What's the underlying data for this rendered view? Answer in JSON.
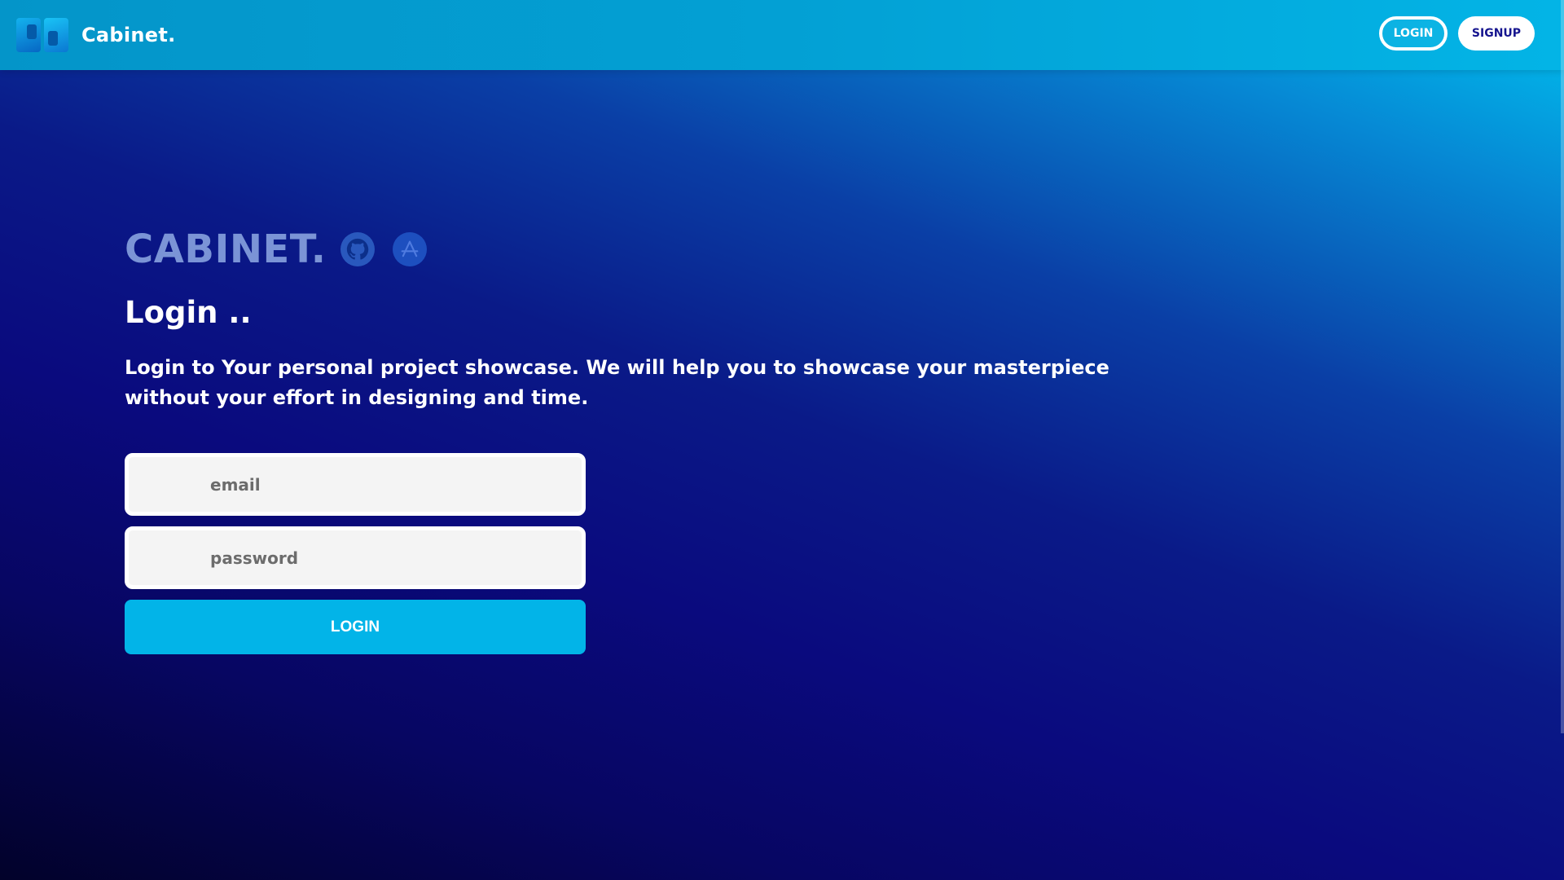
{
  "navbar": {
    "brand_name": "Cabinet.",
    "login_label": "LOGIN",
    "signup_label": "SIGNUP"
  },
  "hero": {
    "big_brand": "CABINET.",
    "social_icons": [
      "github-icon",
      "app-store-icon"
    ],
    "heading": "Login ..",
    "description": "Login to Your personal project showcase. We will help you to showcase your masterpiece without your effort in designing and time."
  },
  "form": {
    "email_placeholder": "email",
    "password_placeholder": "password",
    "submit_label": "LOGIN"
  },
  "colors": {
    "accent": "#02b4e8",
    "navbar": "#03a0d4",
    "brand_muted": "#7b94d6",
    "background_dark": "#0a0a7e"
  }
}
